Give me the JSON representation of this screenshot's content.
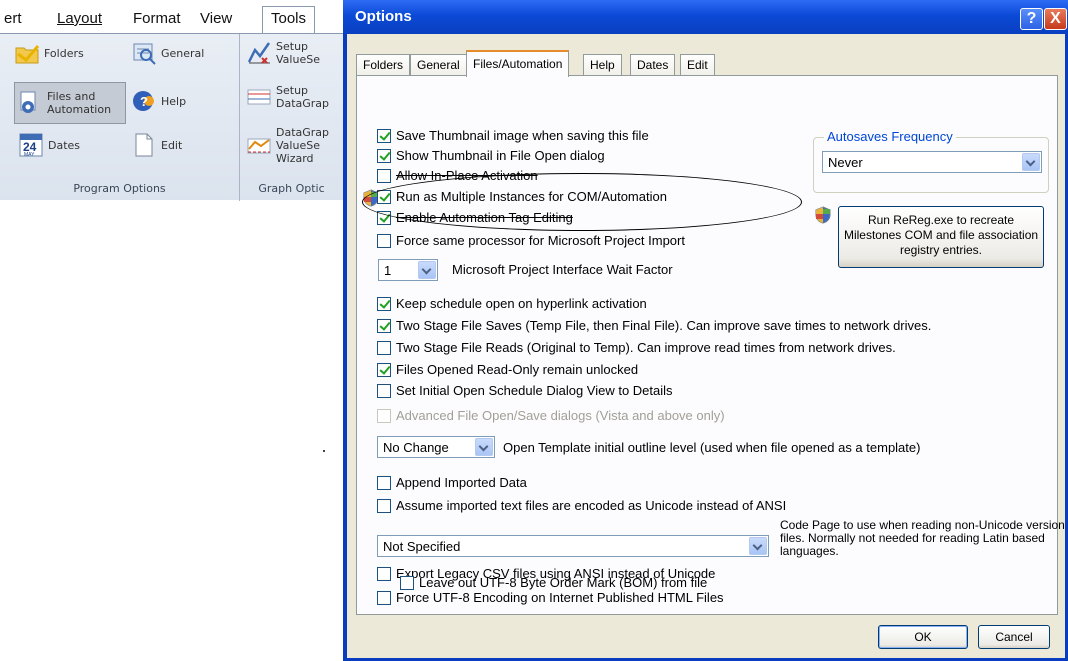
{
  "menubar": {
    "tabs": [
      "ert",
      "Layout",
      "Format",
      "View",
      "Tools"
    ],
    "active_tab": "Tools"
  },
  "ribbon": {
    "program_options": {
      "label": "Program Options",
      "items": [
        {
          "label": "Folders",
          "icon": "folder-icon"
        },
        {
          "label": "General",
          "icon": "general-icon"
        },
        {
          "label": "Files and\nAutomation",
          "icon": "files-automation-icon",
          "selected": true
        },
        {
          "label": "Help",
          "icon": "help-icon"
        },
        {
          "label": "Dates",
          "icon": "calendar-icon"
        },
        {
          "label": "Edit",
          "icon": "document-icon"
        }
      ]
    },
    "graph_options": {
      "label": "Graph Optic",
      "items": [
        {
          "label": "Setup\nValueSe",
          "icon": "graph-line-icon"
        },
        {
          "label": "Setup\nDataGrap",
          "icon": "datagraph-icon"
        },
        {
          "label": "DataGrap\nValueSe\nWizard",
          "icon": "wizard-graph-icon"
        }
      ]
    },
    "calendar_icon_text": {
      "day": "24",
      "month": "MAY"
    }
  },
  "dialog": {
    "title": "Options",
    "help_button": "?",
    "close_button": "X",
    "tabs": [
      "Folders",
      "General",
      "Files/Automation",
      "Help",
      "Dates",
      "Edit"
    ],
    "active_tab": "Files/Automation",
    "options": {
      "save_thumbnail": {
        "label": "Save Thumbnail image when saving this file",
        "checked": true
      },
      "show_thumbnail": {
        "label": "Show Thumbnail in File Open dialog",
        "checked": true
      },
      "allow_in_place": {
        "label": "Allow In-Place Activation",
        "checked": false
      },
      "multiple_instances": {
        "label": "Run as Multiple Instances for COM/Automation",
        "checked": true
      },
      "automation_tag": {
        "label": "Enable Automation Tag Editing",
        "checked": true
      },
      "force_processor": {
        "label": "Force same processor for Microsoft Project Import",
        "checked": false
      },
      "keep_schedule_open": {
        "label": "Keep schedule open on hyperlink activation",
        "checked": true
      },
      "two_stage_saves": {
        "label": "Two Stage File Saves (Temp File, then Final File). Can improve save times to network drives.",
        "checked": true
      },
      "two_stage_reads": {
        "label": "Two Stage File Reads (Original to Temp). Can improve read times from network drives.",
        "checked": false
      },
      "readonly_unlocked": {
        "label": "Files Opened Read-Only remain unlocked",
        "checked": true
      },
      "initial_view_details": {
        "label": "Set Initial Open Schedule Dialog View to Details",
        "checked": false
      },
      "advanced_dialogs": {
        "label": "Advanced File Open/Save dialogs (Vista and above only)",
        "checked": false,
        "disabled": true
      },
      "append_imported": {
        "label": "Append Imported Data",
        "checked": false
      },
      "assume_unicode": {
        "label": "Assume imported text files are encoded as Unicode instead of ANSI",
        "checked": false
      },
      "export_legacy_csv": {
        "label": "Export Legacy CSV files using ANSI instead of Unicode",
        "checked": false
      },
      "force_utf8": {
        "label": "Force UTF-8 Encoding on Internet Published HTML Files",
        "checked": false
      },
      "leave_out_bom": {
        "label": "Leave out UTF-8 Byte Order Mark (BOM) from file",
        "checked": false
      }
    },
    "wait_factor": {
      "value": "1",
      "label": "Microsoft Project Interface Wait Factor"
    },
    "outline_level": {
      "value": "No Change",
      "label": "Open Template initial outline level (used when file opened as a template)"
    },
    "code_page": {
      "value": "Not Specified",
      "note": "Code Page to use when reading non-Unicode version files. Normally not needed for reading Latin based languages."
    },
    "autosave": {
      "legend": "Autosaves Frequency",
      "value": "Never"
    },
    "rereg_button": "Run ReReg.exe to recreate Milestones COM and file association registry entries.",
    "ok_button": "OK",
    "cancel_button": "Cancel"
  },
  "colors": {
    "titlebar": "#0b4ad6",
    "dialog_face": "#ece9d8",
    "panel": "#fcfcfe",
    "check_mark": "#21a121",
    "group_legend": "#0046d5",
    "active_tab_accent": "#e68b2c"
  }
}
